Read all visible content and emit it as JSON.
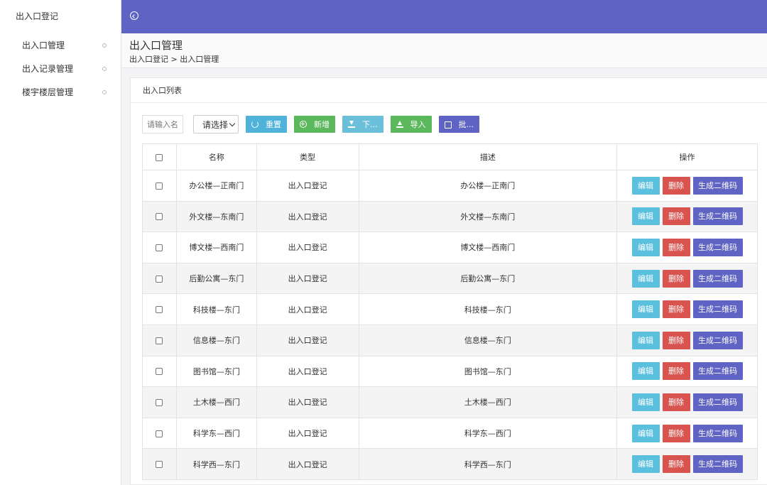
{
  "sidebar": {
    "brand": "出入口登记",
    "items": [
      {
        "label": "出入口管理"
      },
      {
        "label": "出入记录管理"
      },
      {
        "label": "楼宇楼层管理"
      }
    ]
  },
  "header": {
    "title": "出入口管理",
    "breadcrumb": "出入口登记 > 出入口管理"
  },
  "card": {
    "title": "出入口列表"
  },
  "toolbar": {
    "search_placeholder": "请输入名",
    "select_value": "请选择",
    "reset_label": "重置",
    "add_label": "新增",
    "download_label": "下...",
    "import_label": "导入",
    "batch_label": "批..."
  },
  "table": {
    "headers": [
      "名称",
      "类型",
      "描述",
      "操作"
    ],
    "rows": [
      {
        "name": "办公楼—正南门",
        "type": "出入口登记",
        "desc": "办公楼—正南门"
      },
      {
        "name": "外文楼—东南门",
        "type": "出入口登记",
        "desc": "外文楼—东南门"
      },
      {
        "name": "博文楼—西南门",
        "type": "出入口登记",
        "desc": "博文楼—西南门"
      },
      {
        "name": "后勤公寓—东门",
        "type": "出入口登记",
        "desc": "后勤公寓—东门"
      },
      {
        "name": "科技楼—东门",
        "type": "出入口登记",
        "desc": "科技楼—东门"
      },
      {
        "name": "信息楼—东门",
        "type": "出入口登记",
        "desc": "信息楼—东门"
      },
      {
        "name": "图书馆—东门",
        "type": "出入口登记",
        "desc": "图书馆—东门"
      },
      {
        "name": "土木楼—西门",
        "type": "出入口登记",
        "desc": "土木楼—西门"
      },
      {
        "name": "科学东—西门",
        "type": "出入口登记",
        "desc": "科学东—西门"
      },
      {
        "name": "科学西—东门",
        "type": "出入口登记",
        "desc": "科学西—东门"
      }
    ],
    "actions": {
      "edit": "编辑",
      "delete": "删除",
      "qrcode": "生成二维码"
    }
  },
  "colors": {
    "primary": "#5f63c4",
    "info": "#5bc0de",
    "danger": "#d9534f",
    "success": "#5cb85c"
  }
}
